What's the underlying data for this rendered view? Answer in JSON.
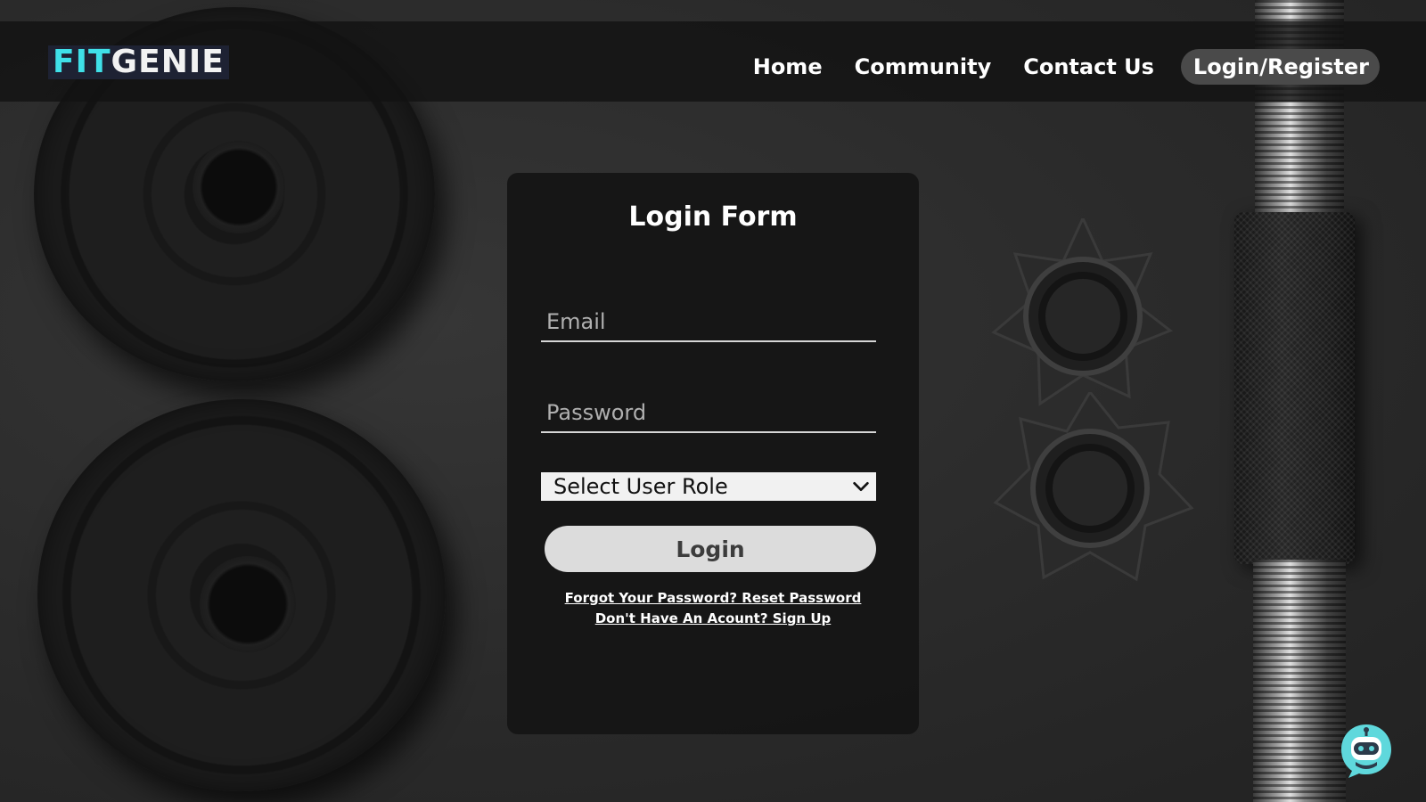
{
  "header": {
    "logo_fit": "FIT",
    "logo_genie": "GENIE",
    "nav": {
      "home": "Home",
      "community": "Community",
      "contact": "Contact Us",
      "login_register": "Login/Register"
    }
  },
  "form": {
    "title": "Login Form",
    "email_placeholder": "Email",
    "password_placeholder": "Password",
    "role_select": "Select User Role",
    "login_button": "Login",
    "forgot_link": "Forgot Your Password? Reset Password",
    "signup_link": "Don't Have An Acount? Sign Up"
  },
  "colors": {
    "accent_logo": "#3fe0e8",
    "chatbot": "#5fd8dc"
  },
  "icons": [
    "chevron-down-icon",
    "chatbot-icon"
  ]
}
